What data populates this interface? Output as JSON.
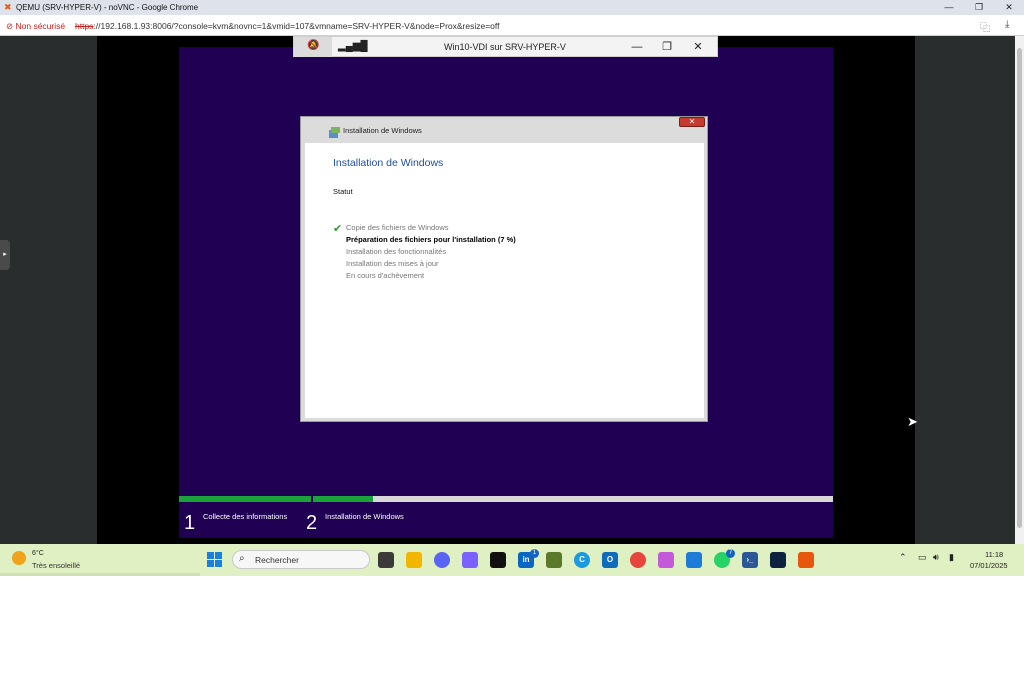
{
  "browser": {
    "window_title": "QEMU (SRV-HYPER-V) - noVNC - Google Chrome",
    "security_label": "Non sécurisé",
    "url_protocol": "https",
    "url_rest": "://192.168.1.93:8006/?console=kvm&novnc=1&vmid=107&vmname=SRV-HYPER-V&node=Prox&resize=off",
    "minimize": "—",
    "restore": "❐",
    "close": "✕",
    "translate_icon": "translate-icon",
    "download_icon": "download-icon"
  },
  "vnc": {
    "title": "Win10-VDI sur SRV-HYPER-V",
    "minimize": "—",
    "restore": "❐",
    "close": "✕"
  },
  "setup": {
    "window_title": "Installation de Windows",
    "heading": "Installation de Windows",
    "status_label": "Statut",
    "steps": [
      "Copie des fichiers de Windows",
      "Préparation des fichiers pour l'installation (7 %)",
      "Installation des fonctionnalités",
      "Installation des mises à jour",
      "En cours d'achèvement"
    ],
    "close": "✕"
  },
  "phases": [
    {
      "num": "1",
      "label": "Collecte des informations"
    },
    {
      "num": "2",
      "label": "Installation de Windows"
    }
  ],
  "progress": {
    "phase1_fraction": 1.0,
    "phase2_fraction": 0.115
  },
  "taskbar": {
    "temperature": "6°C",
    "condition": "Très ensoleillé",
    "search_placeholder": "Rechercher",
    "linkedin_badge": "1",
    "whatsapp_badge": "7",
    "time": "11:18",
    "date": "07/01/2025"
  },
  "colors": {
    "vm_background": "#1f0053",
    "progress_green": "#1aa33a",
    "heading_blue": "#1f4e9c",
    "taskbar": "#dff0c2"
  }
}
